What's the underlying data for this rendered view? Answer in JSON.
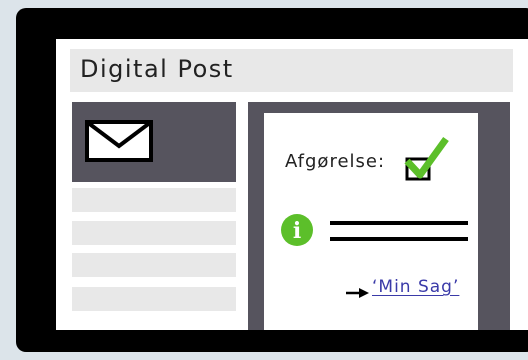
{
  "app": {
    "title": "Digital Post"
  },
  "sidebar": {
    "mail_icon": "envelope-icon",
    "item_count": 4
  },
  "message": {
    "decision_label": "Afgørelse:",
    "decision_checked": true,
    "info_icon": "info-icon",
    "link_text": "‘Min Sag’"
  },
  "colors": {
    "accent_green": "#5cbf2a",
    "panel_dark": "#56545e",
    "link_blue": "#3a3aa8"
  }
}
